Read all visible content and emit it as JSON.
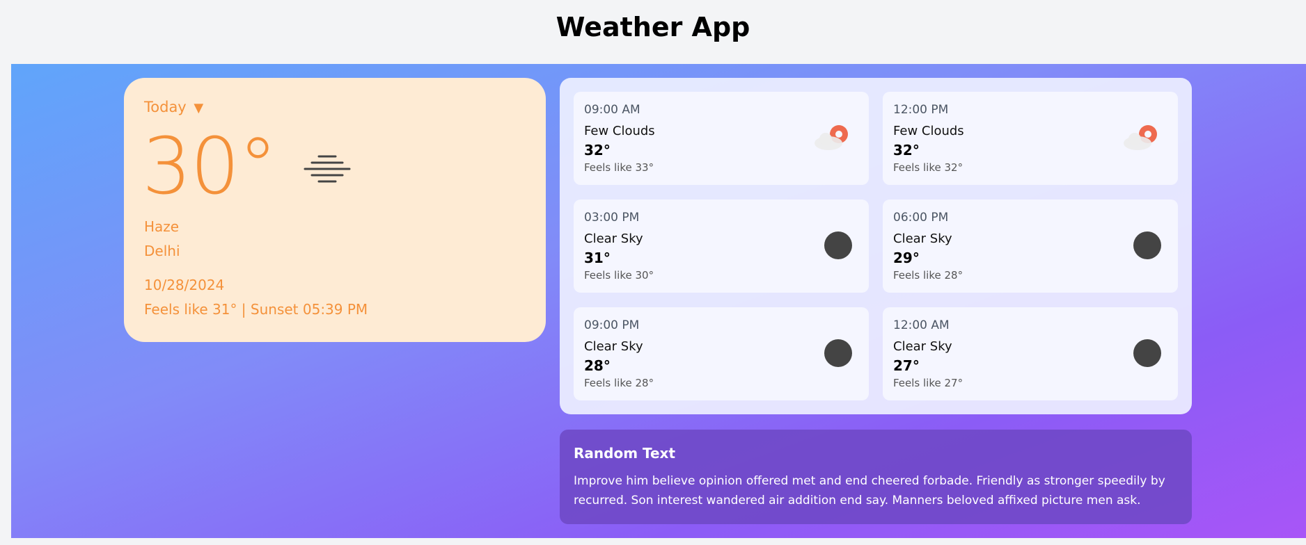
{
  "app": {
    "title": "Weather App"
  },
  "today": {
    "dropdown_label": "Today",
    "caret": "▼",
    "temperature": "30°",
    "condition": "Haze",
    "condition_icon": "haze-icon",
    "city": "Delhi",
    "date": "10/28/2024",
    "meta": "Feels like 31° | Sunset 05:39 PM"
  },
  "forecast": [
    {
      "time": "09:00 AM",
      "condition": "Few Clouds",
      "temp": "32°",
      "feels": "Feels like 33°",
      "icon": "few-clouds-icon"
    },
    {
      "time": "12:00 PM",
      "condition": "Few Clouds",
      "temp": "32°",
      "feels": "Feels like 32°",
      "icon": "few-clouds-icon"
    },
    {
      "time": "03:00 PM",
      "condition": "Clear Sky",
      "temp": "31°",
      "feels": "Feels like 30°",
      "icon": "clear-night-icon"
    },
    {
      "time": "06:00 PM",
      "condition": "Clear Sky",
      "temp": "29°",
      "feels": "Feels like 28°",
      "icon": "clear-night-icon"
    },
    {
      "time": "09:00 PM",
      "condition": "Clear Sky",
      "temp": "28°",
      "feels": "Feels like 28°",
      "icon": "clear-night-icon"
    },
    {
      "time": "12:00 AM",
      "condition": "Clear Sky",
      "temp": "27°",
      "feels": "Feels like 27°",
      "icon": "clear-night-icon"
    }
  ],
  "random": {
    "title": "Random Text",
    "body": "Improve him believe opinion offered met and end cheered forbade. Friendly as stronger speedily by recurred. Son interest wandered air addition end say. Manners beloved affixed picture men ask."
  },
  "colors": {
    "accent_orange": "#f4913a",
    "today_card_bg": "#feebd4",
    "gradient_start": "#60a5fa",
    "gradient_end": "#a855f7",
    "sun_red": "#ee6a4f",
    "moon_gray": "#444444"
  }
}
